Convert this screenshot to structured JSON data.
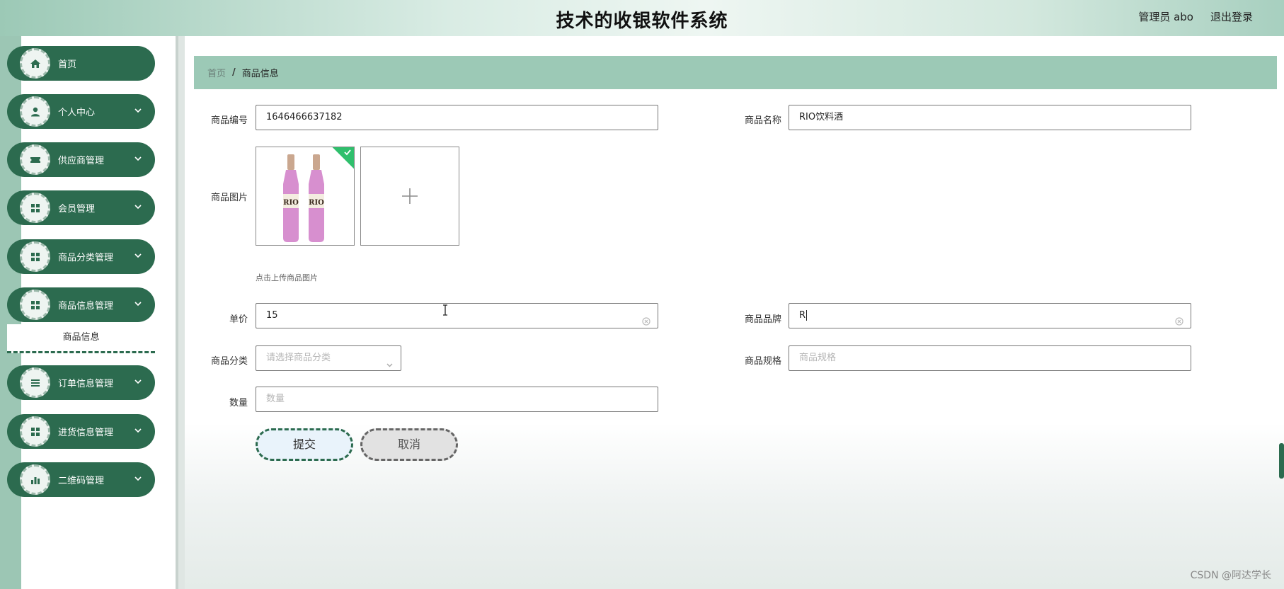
{
  "header": {
    "title": "技术的收银软件系统",
    "user_label": "管理员 abo",
    "logout_label": "退出登录"
  },
  "sidebar": {
    "items": [
      {
        "label": "首页",
        "icon": "home-icon",
        "has_chevron": false
      },
      {
        "label": "个人中心",
        "icon": "user-icon",
        "has_chevron": true
      },
      {
        "label": "供应商管理",
        "icon": "ticket-icon",
        "has_chevron": true
      },
      {
        "label": "会员管理",
        "icon": "grid-icon",
        "has_chevron": true
      },
      {
        "label": "商品分类管理",
        "icon": "grid-icon",
        "has_chevron": true
      },
      {
        "label": "商品信息管理",
        "icon": "grid-icon",
        "has_chevron": true
      },
      {
        "label": "订单信息管理",
        "icon": "list-icon",
        "has_chevron": true
      },
      {
        "label": "进货信息管理",
        "icon": "grid-icon",
        "has_chevron": true
      },
      {
        "label": "二维码管理",
        "icon": "chart-icon",
        "has_chevron": true
      }
    ],
    "active_sub_item": "商品信息"
  },
  "breadcrumb": {
    "home": "首页",
    "separator": "/",
    "current": "商品信息"
  },
  "form": {
    "code": {
      "label": "商品编号",
      "value": "1646466637182"
    },
    "name": {
      "label": "商品名称",
      "value": "RIO饮料酒"
    },
    "image": {
      "label": "商品图片",
      "hint": "点击上传商品图片"
    },
    "price": {
      "label": "单价",
      "value": "15"
    },
    "brand": {
      "label": "商品品牌",
      "value": "R"
    },
    "category": {
      "label": "商品分类",
      "placeholder": "请选择商品分类"
    },
    "spec": {
      "label": "商品规格",
      "placeholder": "商品规格"
    },
    "quantity": {
      "label": "数量",
      "placeholder": "数量"
    },
    "submit_label": "提交",
    "cancel_label": "取消"
  },
  "watermark": "CSDN @阿达学长",
  "colors": {
    "primary": "#2c6b4f",
    "header_bg": "#9cc9b6",
    "breadcrumb_bg": "#9cc9b6",
    "success": "#2fbf6c"
  }
}
